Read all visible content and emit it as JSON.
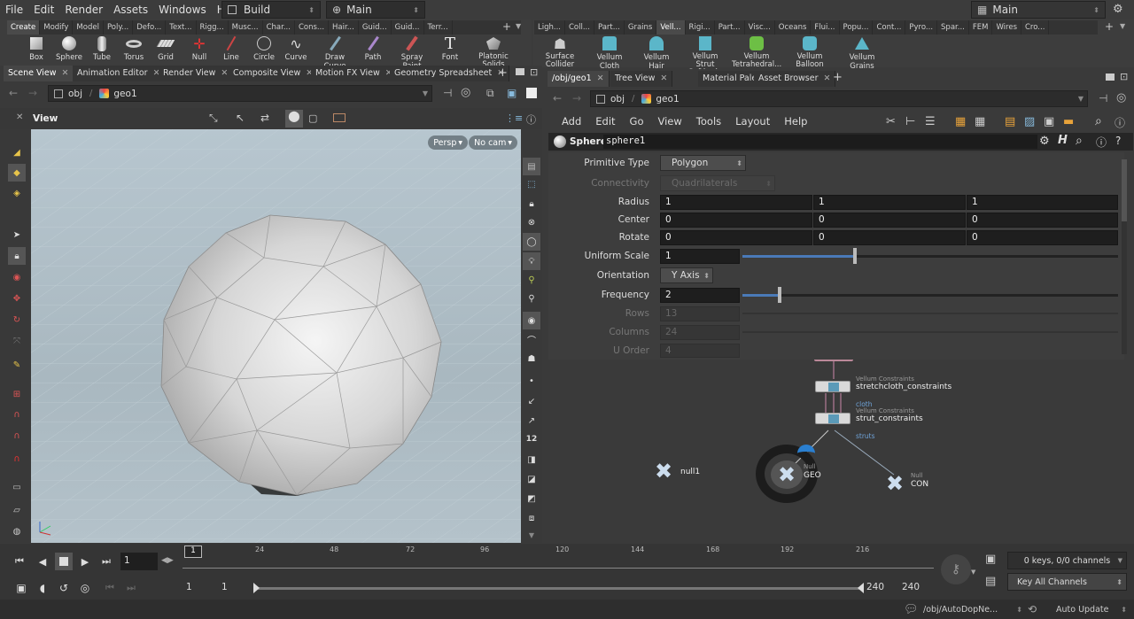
{
  "menubar": {
    "items": [
      "File",
      "Edit",
      "Render",
      "Assets",
      "Windows",
      "Help"
    ],
    "desktop_left": "Build",
    "network_left": "Main",
    "desktop_right": "Main"
  },
  "shelf_left": {
    "tabs": [
      "Create",
      "Modify",
      "Model",
      "Poly...",
      "Defo...",
      "Text...",
      "Rigg...",
      "Musc...",
      "Char...",
      "Cons...",
      "Hair...",
      "Guid...",
      "Guid...",
      "Terr..."
    ],
    "tools": [
      "Box",
      "Sphere",
      "Tube",
      "Torus",
      "Grid",
      "Null",
      "Line",
      "Circle",
      "Curve",
      "Draw Curve",
      "Path",
      "Spray Paint",
      "Font",
      "Platonic Solids"
    ]
  },
  "shelf_right": {
    "tabs": [
      "Ligh...",
      "Coll...",
      "Part...",
      "Grains",
      "Vell...",
      "Rigi...",
      "Part...",
      "Visc...",
      "Oceans",
      "Flui...",
      "Popu...",
      "Cont...",
      "Pyro...",
      "Spar...",
      "FEM",
      "Wires",
      "Cro..."
    ],
    "tools": [
      "Surface Collider",
      "Vellum Cloth",
      "Vellum Hair",
      "Vellum Strut Softbody",
      "Vellum Tetrahedral...",
      "Vellum Balloon",
      "Vellum Grains"
    ]
  },
  "left_pane": {
    "tabs": [
      "Scene View",
      "Animation Editor",
      "Render View",
      "Composite View",
      "Motion FX View",
      "Geometry Spreadsheet"
    ],
    "path": [
      "obj",
      "geo1"
    ],
    "view_label": "View",
    "persp": "Persp",
    "cam": "No cam"
  },
  "right_pane": {
    "tabs": [
      "/obj/geo1",
      "Tree View",
      "Material Palette",
      "Asset Browser"
    ],
    "path": [
      "obj",
      "geo1"
    ],
    "menus": [
      "Add",
      "Edit",
      "Go",
      "View",
      "Tools",
      "Layout",
      "Help"
    ],
    "node_type": "Sphere",
    "node_name": "sphere1"
  },
  "params": {
    "primitive_type": {
      "label": "Primitive Type",
      "value": "Polygon"
    },
    "connectivity": {
      "label": "Connectivity",
      "value": "Quadrilaterals"
    },
    "radius": {
      "label": "Radius",
      "values": [
        "1",
        "1",
        "1"
      ]
    },
    "center": {
      "label": "Center",
      "values": [
        "0",
        "0",
        "0"
      ]
    },
    "rotate": {
      "label": "Rotate",
      "values": [
        "0",
        "0",
        "0"
      ]
    },
    "uniform_scale": {
      "label": "Uniform Scale",
      "value": "1",
      "fraction": 0.3
    },
    "orientation": {
      "label": "Orientation",
      "value": "Y Axis"
    },
    "frequency": {
      "label": "Frequency",
      "value": "2",
      "fraction": 0.1
    },
    "rows": {
      "label": "Rows",
      "value": "13"
    },
    "columns": {
      "label": "Columns",
      "value": "24"
    },
    "u_order": {
      "label": "U Order",
      "value": "4"
    }
  },
  "network": {
    "stretch": {
      "type": "Vellum Constraints",
      "name": "stretchcloth_constraints",
      "sub": "cloth"
    },
    "strut": {
      "type": "Vellum Constraints",
      "name": "strut_constraints",
      "sub": "struts"
    },
    "null1": {
      "name": "null1"
    },
    "geo": {
      "type": "Null",
      "name": "GEO"
    },
    "con": {
      "type": "Null",
      "name": "CON"
    }
  },
  "timeline": {
    "current_frame": "1",
    "ticks": [
      "24",
      "48",
      "72",
      "96",
      "120",
      "144",
      "168",
      "192",
      "216"
    ],
    "range_start": "1",
    "range_start2": "1",
    "range_end": "240",
    "range_end2": "240",
    "keys_info": "0 keys, 0/0 channels",
    "key_mode": "Key All Channels",
    "current_marker": "1"
  },
  "statusbar": {
    "path": "/obj/AutoDopNe...",
    "update": "Auto Update"
  }
}
